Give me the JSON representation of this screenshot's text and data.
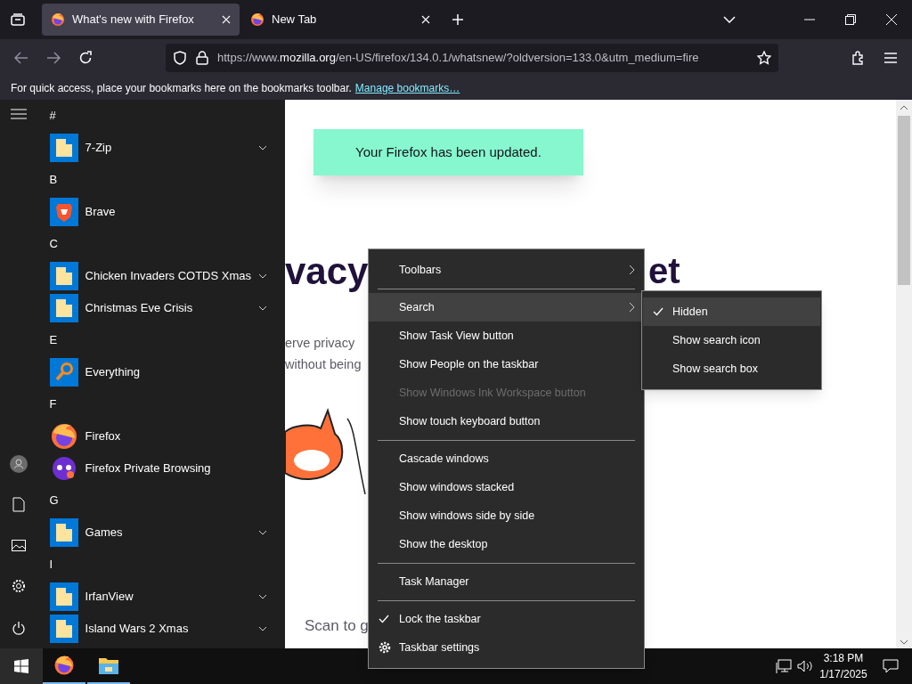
{
  "browser": {
    "tabs": [
      {
        "label": "What's new with Firefox",
        "selected": true
      },
      {
        "label": "New Tab",
        "selected": false
      }
    ],
    "url": {
      "scheme": "https://www.",
      "domain": "mozilla.org",
      "path": "/en-US/firefox/134.0.1/whatsnew/?oldversion=133.0&utm_medium=fire"
    },
    "bookmarks_hint": {
      "text": "For quick access, place your bookmarks here on the bookmarks toolbar.",
      "link": "Manage bookmarks…"
    }
  },
  "page": {
    "banner": "Your Firefox has been updated.",
    "heading_left": "vacy",
    "heading_right": "et",
    "body_lines": [
      "erve privacy",
      "without being"
    ],
    "scan_text": "Scan to g"
  },
  "start_menu": {
    "groups": [
      {
        "letter": "#",
        "apps": [
          {
            "name": "7-Zip",
            "kind": "folder",
            "expandable": true
          }
        ]
      },
      {
        "letter": "B",
        "apps": [
          {
            "name": "Brave",
            "kind": "brave",
            "expandable": false
          }
        ]
      },
      {
        "letter": "C",
        "apps": [
          {
            "name": "Chicken Invaders COTDS Xmas",
            "kind": "folder",
            "expandable": true
          },
          {
            "name": "Christmas Eve Crisis",
            "kind": "folder",
            "expandable": true
          }
        ]
      },
      {
        "letter": "E",
        "apps": [
          {
            "name": "Everything",
            "kind": "magnifier",
            "expandable": false
          }
        ]
      },
      {
        "letter": "F",
        "apps": [
          {
            "name": "Firefox",
            "kind": "firefox",
            "expandable": false
          },
          {
            "name": "Firefox Private Browsing",
            "kind": "private",
            "expandable": false
          }
        ]
      },
      {
        "letter": "G",
        "apps": [
          {
            "name": "Games",
            "kind": "folder",
            "expandable": true
          }
        ]
      },
      {
        "letter": "I",
        "apps": [
          {
            "name": "IrfanView",
            "kind": "folder",
            "expandable": true
          },
          {
            "name": "Island Wars 2 Xmas",
            "kind": "folder",
            "expandable": true
          }
        ]
      }
    ]
  },
  "context_menu": {
    "items": [
      {
        "kind": "item",
        "label": "Toolbars",
        "submenu": true,
        "checked": false,
        "disabled": false,
        "selected": false
      },
      {
        "kind": "separator"
      },
      {
        "kind": "item",
        "label": "Search",
        "submenu": true,
        "checked": false,
        "disabled": false,
        "selected": true
      },
      {
        "kind": "item",
        "label": "Show Task View button",
        "submenu": false,
        "checked": false,
        "disabled": false,
        "selected": false
      },
      {
        "kind": "item",
        "label": "Show People on the taskbar",
        "submenu": false,
        "checked": false,
        "disabled": false,
        "selected": false
      },
      {
        "kind": "item",
        "label": "Show Windows Ink Workspace button",
        "submenu": false,
        "checked": false,
        "disabled": true,
        "selected": false
      },
      {
        "kind": "item",
        "label": "Show touch keyboard button",
        "submenu": false,
        "checked": false,
        "disabled": false,
        "selected": false
      },
      {
        "kind": "separator"
      },
      {
        "kind": "item",
        "label": "Cascade windows",
        "submenu": false,
        "checked": false,
        "disabled": false,
        "selected": false
      },
      {
        "kind": "item",
        "label": "Show windows stacked",
        "submenu": false,
        "checked": false,
        "disabled": false,
        "selected": false
      },
      {
        "kind": "item",
        "label": "Show windows side by side",
        "submenu": false,
        "checked": false,
        "disabled": false,
        "selected": false
      },
      {
        "kind": "item",
        "label": "Show the desktop",
        "submenu": false,
        "checked": false,
        "disabled": false,
        "selected": false
      },
      {
        "kind": "separator"
      },
      {
        "kind": "item",
        "label": "Task Manager",
        "submenu": false,
        "checked": false,
        "disabled": false,
        "selected": false
      },
      {
        "kind": "separator"
      },
      {
        "kind": "item",
        "label": "Lock the taskbar",
        "submenu": false,
        "checked": true,
        "disabled": false,
        "selected": false
      },
      {
        "kind": "gear-item",
        "label": "Taskbar settings",
        "submenu": false,
        "checked": false,
        "disabled": false,
        "selected": false
      }
    ]
  },
  "search_submenu": {
    "items": [
      {
        "label": "Hidden",
        "checked": true,
        "selected": true
      },
      {
        "label": "Show search icon",
        "checked": false,
        "selected": false
      },
      {
        "label": "Show search box",
        "checked": false,
        "selected": false
      }
    ]
  },
  "taskbar": {
    "start_open": true,
    "apps": [
      {
        "kind": "firefox",
        "running": true
      },
      {
        "kind": "explorer",
        "running": true
      }
    ],
    "time": "3:18 PM",
    "date": "1/17/2025"
  }
}
